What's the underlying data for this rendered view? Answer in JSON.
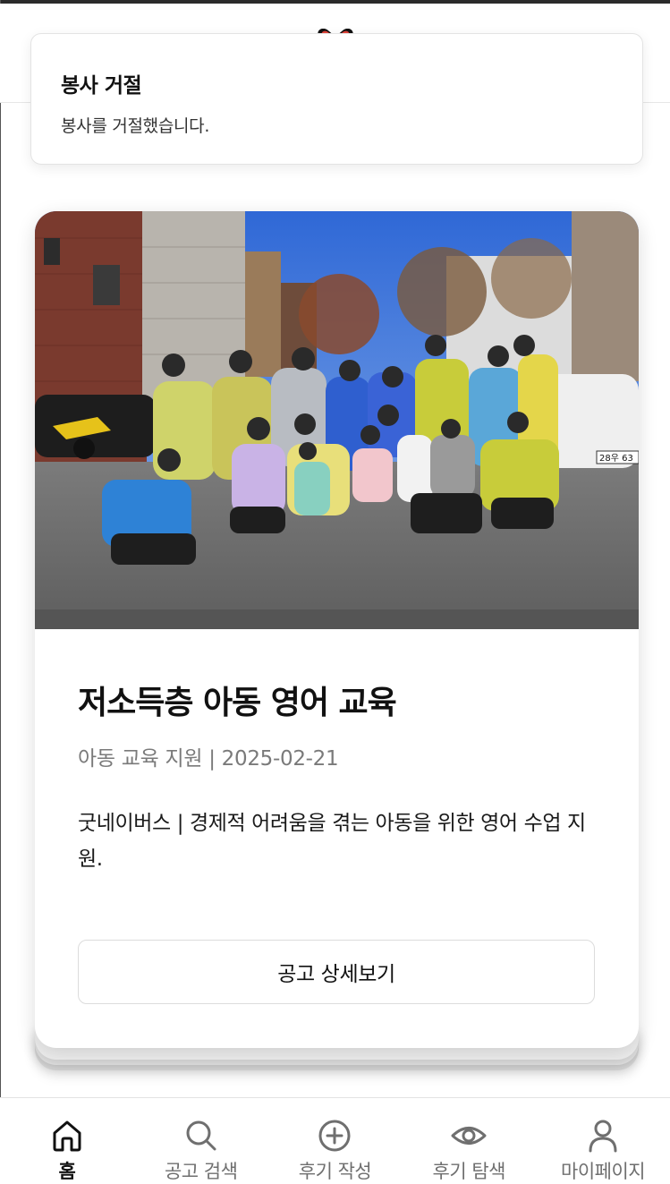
{
  "toast": {
    "title": "봉사 거절",
    "message": "봉사를 거절했습니다."
  },
  "card": {
    "title": "저소득층 아동 영어 교육",
    "meta": "아동 교육 지원 | 2025-02-21",
    "description": "굿네이버스 | 경제적 어려움을 겪는 아동을 위한 영어 수업 지원.",
    "button_label": "공고 상세보기",
    "photo_sign_text": "28우 63"
  },
  "bottom_nav": {
    "items": [
      {
        "label": "홈",
        "icon": "home-icon",
        "active": true
      },
      {
        "label": "공고 검색",
        "icon": "search-icon",
        "active": false
      },
      {
        "label": "후기 작성",
        "icon": "plus-circle-icon",
        "active": false
      },
      {
        "label": "후기 탐색",
        "icon": "eye-icon",
        "active": false
      },
      {
        "label": "마이페이지",
        "icon": "person-icon",
        "active": false
      }
    ]
  },
  "colors": {
    "active_nav": "#111111",
    "inactive_nav": "#6f6f6f",
    "logo_red": "#e0443a"
  }
}
